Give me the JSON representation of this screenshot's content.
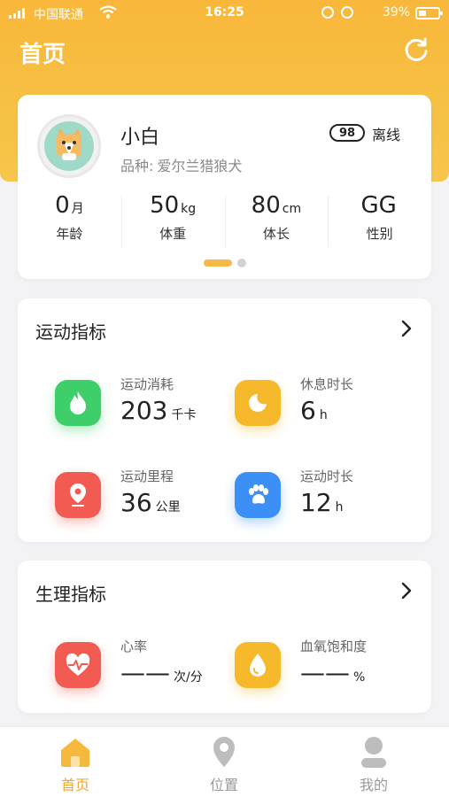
{
  "statusbar": {
    "carrier": "中国联通",
    "time": "16:25",
    "battery": "39%",
    "battery_level": 0.39
  },
  "header": {
    "title": "首页"
  },
  "pet": {
    "name": "小白",
    "breed_label": "品种:",
    "breed": "爱尔兰猎狼犬",
    "badge": "98",
    "status": "离线",
    "stats": [
      {
        "value": "0",
        "unit": "月",
        "label": "年龄"
      },
      {
        "value": "50",
        "unit": "kg",
        "label": "体重"
      },
      {
        "value": "80",
        "unit": "cm",
        "label": "体长"
      },
      {
        "value": "GG",
        "unit": "",
        "label": "性别"
      }
    ],
    "carousel": {
      "pages": 2,
      "active": 1
    }
  },
  "exercise": {
    "title": "运动指标",
    "metrics": [
      {
        "label": "运动消耗",
        "value": "203",
        "unit": "千卡",
        "icon": "flame-icon"
      },
      {
        "label": "休息时长",
        "value": "6",
        "unit": "h",
        "icon": "moon-sleep-icon"
      },
      {
        "label": "运动里程",
        "value": "36",
        "unit": "公里",
        "icon": "location-pin-icon"
      },
      {
        "label": "运动时长",
        "value": "12",
        "unit": "h",
        "icon": "paw-icon"
      }
    ]
  },
  "physiology": {
    "title": "生理指标",
    "metrics": [
      {
        "label": "心率",
        "value": "——",
        "unit": "次/分",
        "icon": "heart-pulse-icon"
      },
      {
        "label": "血氧饱和度",
        "value": "——",
        "unit": "%",
        "icon": "drop-icon"
      }
    ]
  },
  "tabbar": {
    "items": [
      {
        "label": "首页",
        "icon": "home-icon",
        "active": true
      },
      {
        "label": "位置",
        "icon": "location-icon",
        "active": false
      },
      {
        "label": "我的",
        "icon": "user-icon",
        "active": false
      }
    ]
  },
  "colors": {
    "accent": "#f6b93b",
    "green": "#3fcf6a",
    "yellow": "#f6b92c",
    "red": "#f25b52",
    "blue": "#3c8ff5",
    "inactive_tab": "#b7b7b7"
  }
}
